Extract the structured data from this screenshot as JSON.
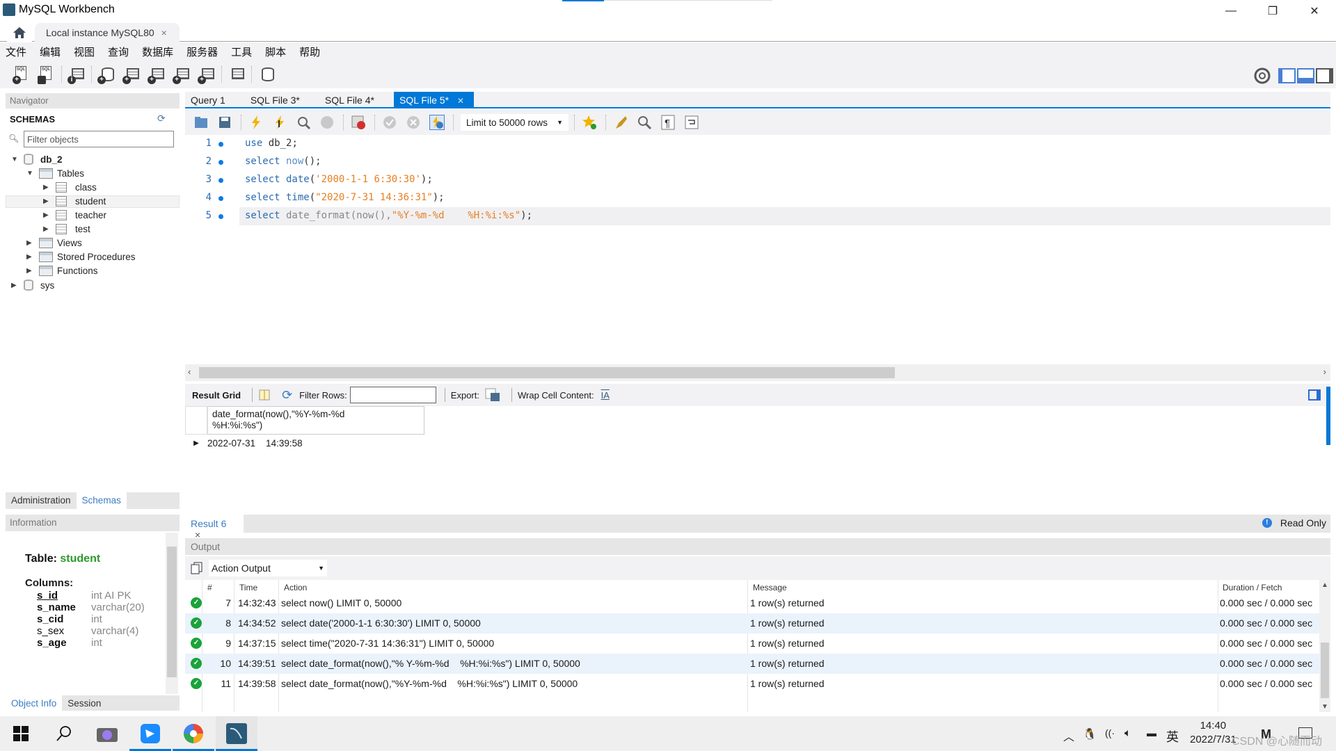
{
  "window": {
    "title": "MySQL Workbench",
    "controls": {
      "minimize": "—",
      "restore": "❐",
      "close": "✕"
    }
  },
  "connection_tab": {
    "label": "Local instance MySQL80",
    "close": "×"
  },
  "menu": [
    "文件",
    "编辑",
    "视图",
    "查询",
    "数据库",
    "服务器",
    "工具",
    "脚本",
    "帮助"
  ],
  "navigator": {
    "header": "Navigator",
    "schemas_label": "SCHEMAS",
    "filter_placeholder": "Filter objects",
    "tree": {
      "db_2": "db_2",
      "tables": "Tables",
      "table_items": [
        "class",
        "student",
        "teacher",
        "test"
      ],
      "views": "Views",
      "procedures": "Stored Procedures",
      "functions": "Functions",
      "sys": "sys"
    },
    "selected_table": "student",
    "tabs": [
      "Administration",
      "Schemas"
    ],
    "active_tab": "Schemas"
  },
  "information": {
    "header": "Information",
    "table_label": "Table:",
    "table_name": "student",
    "columns_label": "Columns:",
    "columns": [
      {
        "name": "s_id",
        "type": "int AI PK"
      },
      {
        "name": "s_name",
        "type": "varchar(20)"
      },
      {
        "name": "s_cid",
        "type": "int"
      },
      {
        "name": "s_sex",
        "type": "varchar(4)"
      },
      {
        "name": "s_age",
        "type": "int"
      }
    ],
    "bottom_tabs": [
      "Object Info",
      "Session"
    ]
  },
  "editor_tabs": [
    {
      "label": "Query 1",
      "active": false
    },
    {
      "label": "SQL File 3*",
      "active": false
    },
    {
      "label": "SQL File 4*",
      "active": false
    },
    {
      "label": "SQL File 5*",
      "active": true
    }
  ],
  "sql_toolbar": {
    "limit": "Limit to 50000 rows"
  },
  "editor": {
    "lines": [
      {
        "n": "1",
        "kw": "use",
        "rest": " db_2;"
      },
      {
        "n": "2",
        "kw": "select",
        "fn": " now",
        "rest": "();"
      },
      {
        "n": "3",
        "kw": "select",
        "fn": " date",
        "open": "(",
        "str": "'2000-1-1 6:30:30'",
        "rest": ");"
      },
      {
        "n": "4",
        "kw": "select",
        "fn": " time",
        "open": "(",
        "str": "\"2020-7-31 14:36:31\"",
        "rest": ");"
      },
      {
        "n": "5",
        "kw": "select",
        "fn": " date_format(now(),",
        "str": "\"%Y-%m-%d    %H:%i:%s\"",
        "rest": ");"
      }
    ]
  },
  "result_toolbar": {
    "result_grid": "Result Grid",
    "filter_rows": "Filter Rows:",
    "filter_value": "",
    "export": "Export:",
    "wrap": "Wrap Cell Content:"
  },
  "result_grid": {
    "header_line1": "date_format(now(),\"%Y-%m-%d",
    "header_line2": "%H:%i:%s\")",
    "row": "2022-07-31    14:39:58"
  },
  "result_tab": {
    "label": "Result 6",
    "close": "×",
    "status": "Read Only"
  },
  "output": {
    "header": "Output",
    "mode": "Action Output",
    "columns": [
      "#",
      "Time",
      "Action",
      "Message",
      "Duration / Fetch"
    ],
    "rows": [
      {
        "num": "7",
        "time": "14:32:43",
        "action": "select now() LIMIT 0, 50000",
        "message": "1 row(s) returned",
        "duration": "0.000 sec / 0.000 sec"
      },
      {
        "num": "8",
        "time": "14:34:52",
        "action": "select date('2000-1-1 6:30:30') LIMIT 0, 50000",
        "message": "1 row(s) returned",
        "duration": "0.000 sec / 0.000 sec"
      },
      {
        "num": "9",
        "time": "14:37:15",
        "action": "select time(\"2020-7-31 14:36:31\") LIMIT 0, 50000",
        "message": "1 row(s) returned",
        "duration": "0.000 sec / 0.000 sec"
      },
      {
        "num": "10",
        "time": "14:39:51",
        "action": "select date_format(now(),\"% Y-%m-%d    %H:%i:%s\") LIMIT 0, 50000",
        "message": "1 row(s) returned",
        "duration": "0.000 sec / 0.000 sec"
      },
      {
        "num": "11",
        "time": "14:39:58",
        "action": "select date_format(now(),\"%Y-%m-%d    %H:%i:%s\") LIMIT 0, 50000",
        "message": "1 row(s) returned",
        "duration": "0.000 sec / 0.000 sec"
      }
    ]
  },
  "taskbar": {
    "time": "14:40",
    "date": "2022/7/31",
    "ime": "英",
    "watermark": "CSDN @心随而动"
  }
}
